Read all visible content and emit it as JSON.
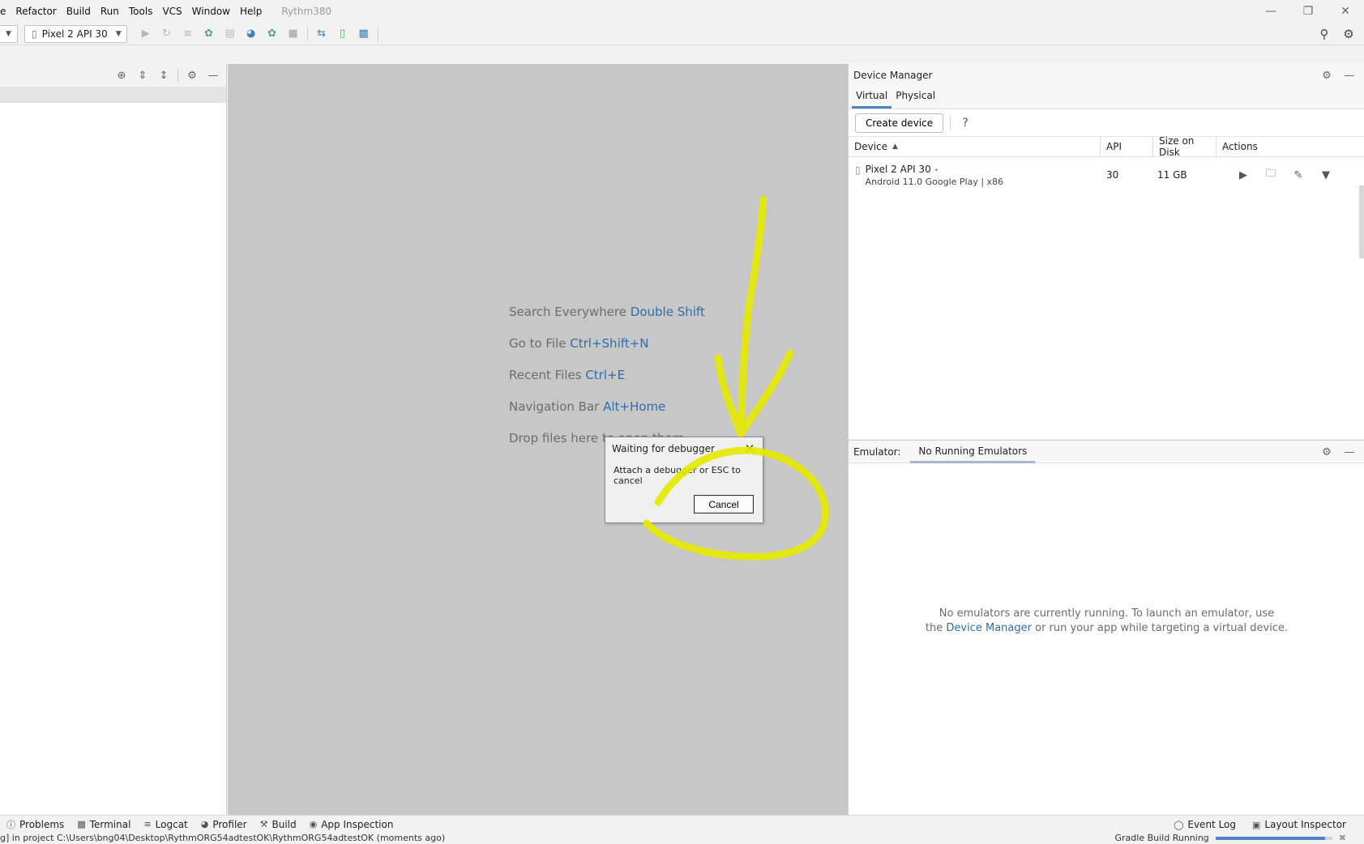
{
  "menu": {
    "partial_first": "e",
    "items": [
      "Refactor",
      "Build",
      "Run",
      "Tools",
      "VCS",
      "Window",
      "Help"
    ],
    "project_name": "Rythm380"
  },
  "toolbar": {
    "device_label": "Pixel 2 API 30"
  },
  "editor_hints": [
    {
      "text": "Search Everywhere",
      "key": "Double Shift"
    },
    {
      "text": "Go to File",
      "key": "Ctrl+Shift+N"
    },
    {
      "text": "Recent Files",
      "key": "Ctrl+E"
    },
    {
      "text": "Navigation Bar",
      "key": "Alt+Home"
    },
    {
      "text": "Drop files here to open them",
      "key": ""
    }
  ],
  "device_manager": {
    "title": "Device Manager",
    "tabs": [
      "Virtual",
      "Physical"
    ],
    "create_label": "Create device",
    "help": "?",
    "columns": [
      "Device",
      "API",
      "Size on Disk",
      "Actions"
    ],
    "device": {
      "name": "Pixel 2 API 30",
      "status_dot": "•",
      "subtitle": "Android 11.0 Google Play | x86",
      "api": "30",
      "size": "11 GB"
    }
  },
  "emulator": {
    "label": "Emulator:",
    "tab": "No Running Emulators",
    "message_line1": "No emulators are currently running. To launch an emulator, use",
    "message_prefix": "the",
    "message_link": "Device Manager",
    "message_suffix": "or run your app while targeting a virtual device."
  },
  "dialog": {
    "title": "Waiting for debugger",
    "message": "Attach a debugger or ESC to cancel",
    "cancel": "Cancel"
  },
  "bottom_tools": [
    "Problems",
    "Terminal",
    "Logcat",
    "Profiler",
    "Build",
    "App Inspection"
  ],
  "bottom_right_tools": [
    "Event Log",
    "Layout Inspector"
  ],
  "status": {
    "text": "g] in project C:\\Users\\bng04\\Desktop\\RythmORG54adtestOK\\RythmORG54adtestOK (moments ago)",
    "task": "Gradle Build Running",
    "progress": 0.94
  },
  "colors": {
    "link": "#2f6dac",
    "annotation": "#e6ea00",
    "tab_active": "#4a86c7",
    "running_dot": "#59a869"
  }
}
